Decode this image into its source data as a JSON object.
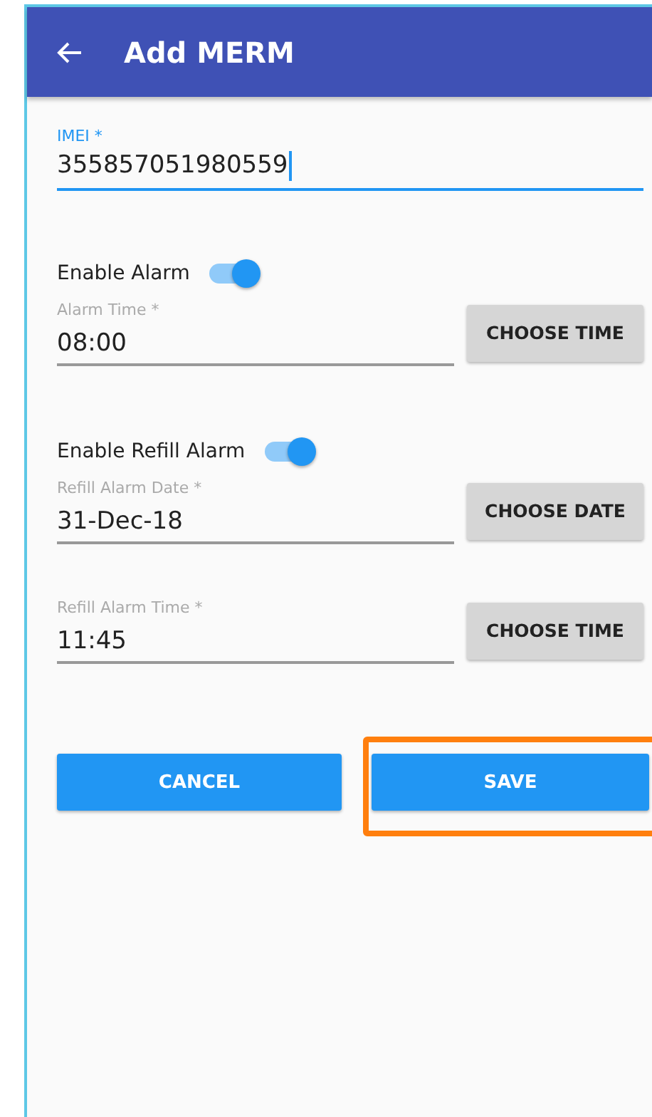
{
  "app_bar": {
    "title": "Add MERM"
  },
  "imei": {
    "label": "IMEI *",
    "value": "355857051980559",
    "focused": true
  },
  "sections": [
    {
      "toggle": {
        "label": "Enable Alarm",
        "on": true
      },
      "fields": [
        {
          "label": "Alarm Time *",
          "value": "08:00",
          "button": "CHOOSE TIME"
        }
      ]
    },
    {
      "toggle": {
        "label": "Enable Refill Alarm",
        "on": true
      },
      "fields": [
        {
          "label": "Refill Alarm Date *",
          "value": "31-Dec-18",
          "button": "CHOOSE DATE"
        },
        {
          "label": "Refill Alarm Time *",
          "value": "11:45",
          "button": "CHOOSE TIME"
        }
      ]
    }
  ],
  "actions": [
    {
      "label": "CANCEL",
      "highlighted": false
    },
    {
      "label": "SAVE",
      "highlighted": true
    }
  ]
}
